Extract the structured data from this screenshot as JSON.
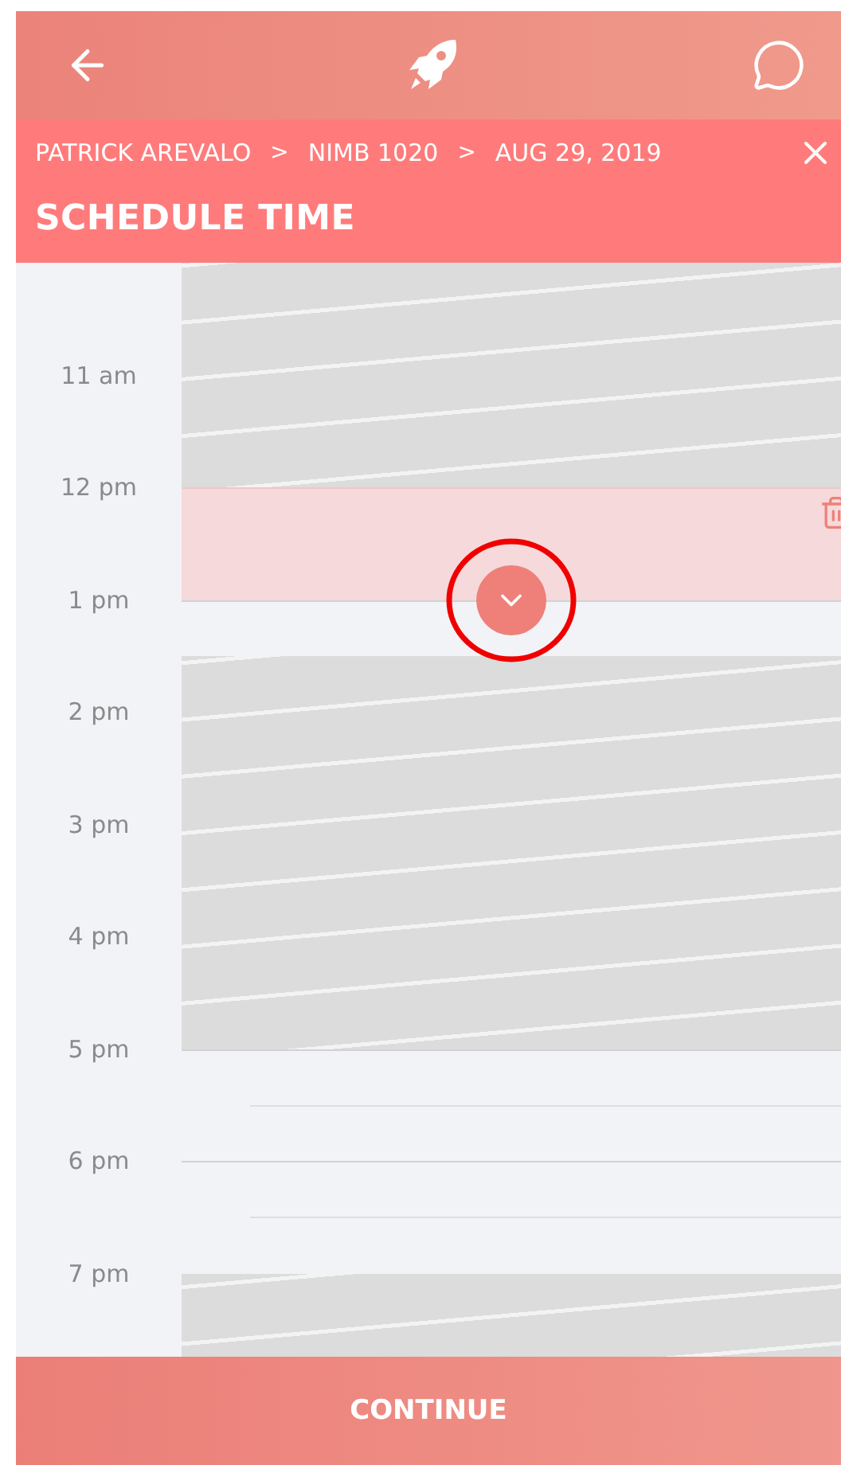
{
  "breadcrumb": [
    {
      "label": "PATRICK AREVALO",
      "separator": ">"
    },
    {
      "label": "NIMB 1020",
      "separator": ">"
    },
    {
      "label": "AUG 29, 2019"
    }
  ],
  "title": "SCHEDULE TIME",
  "hours": [
    "11 am",
    "12 pm",
    "1 pm",
    "2 pm",
    "3 pm",
    "4 pm",
    "5 pm",
    "6 pm",
    "7 pm"
  ],
  "slots": [
    {
      "kind": "unavailable"
    },
    {
      "kind": "unavailable"
    },
    {
      "kind": "unavailable"
    },
    {
      "kind": "unavailable"
    },
    {
      "kind": "selected"
    },
    {
      "kind": "selected"
    },
    {
      "kind": "free"
    },
    {
      "kind": "unavailable"
    },
    {
      "kind": "unavailable"
    },
    {
      "kind": "unavailable"
    },
    {
      "kind": "unavailable"
    },
    {
      "kind": "unavailable"
    },
    {
      "kind": "unavailable"
    },
    {
      "kind": "unavailable"
    },
    {
      "kind": "free"
    },
    {
      "kind": "free"
    },
    {
      "kind": "free"
    },
    {
      "kind": "free"
    },
    {
      "kind": "unavailable"
    },
    {
      "kind": "unavailable"
    }
  ],
  "continue_button": "CONTINUE"
}
